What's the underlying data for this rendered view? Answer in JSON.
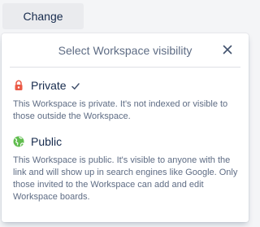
{
  "change_button": {
    "label": "Change"
  },
  "popover": {
    "title": "Select Workspace visibility",
    "close_icon": "close-icon"
  },
  "options": [
    {
      "name": "Private",
      "icon": "lock-icon",
      "icon_color": "#eb5a46",
      "selected": true,
      "description": "This Workspace is private. It's not indexed or visible to those outside the Workspace."
    },
    {
      "name": "Public",
      "icon": "globe-icon",
      "icon_color": "#61bd4f",
      "selected": false,
      "description": "This Workspace is public. It's visible to anyone with the link and will show up in search engines like Google. Only those invited to the Workspace can add and edit Workspace boards."
    }
  ]
}
